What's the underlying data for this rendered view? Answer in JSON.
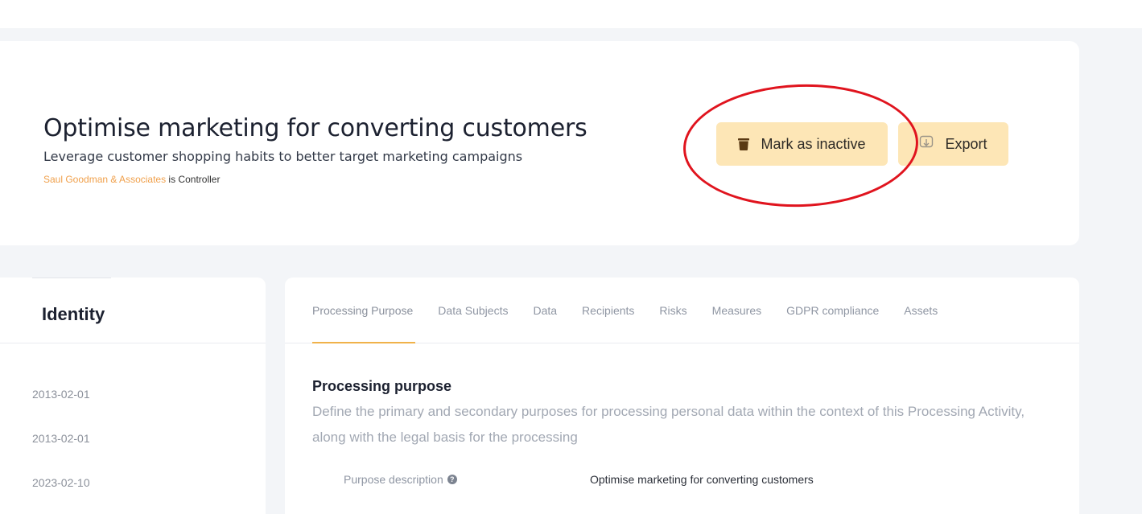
{
  "activity": {
    "title": "Optimise marketing for converting customers",
    "subtitle": "Leverage customer shopping habits to better target marketing campaigns",
    "controller_org": "Saul Goodman & Associates",
    "controller_suffix": " is Controller"
  },
  "actions": {
    "mark_inactive_label": "Mark as inactive",
    "mark_inactive_icon": "trash-icon",
    "export_label": "Export",
    "export_icon": "download-icon"
  },
  "left_panel": {
    "heading": "Identity",
    "dates": [
      "2013-02-01",
      "2013-02-01",
      "2023-02-10"
    ]
  },
  "tabs": [
    {
      "label": "Processing Purpose",
      "active": true
    },
    {
      "label": "Data Subjects",
      "active": false
    },
    {
      "label": "Data",
      "active": false
    },
    {
      "label": "Recipients",
      "active": false
    },
    {
      "label": "Risks",
      "active": false
    },
    {
      "label": "Measures",
      "active": false
    },
    {
      "label": "GDPR compliance",
      "active": false
    },
    {
      "label": "Assets",
      "active": false
    }
  ],
  "section": {
    "title": "Processing purpose",
    "description": "Define the primary and secondary purposes for processing personal data within the context of this Processing Activity, along with the legal basis for the processing",
    "field_label": "Purpose description",
    "field_value": "Optimise marketing for converting customers"
  },
  "colors": {
    "accent": "#f0a04b",
    "button_bg": "#fde6b6",
    "annotation": "#e0141e",
    "tab_underline": "#f0b24a"
  }
}
